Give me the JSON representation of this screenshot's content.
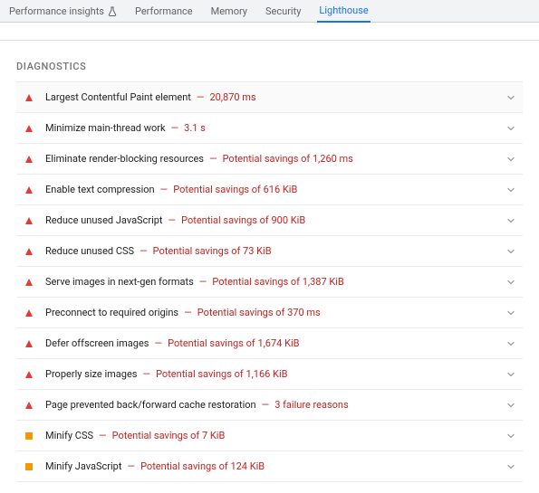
{
  "tabs": {
    "performance_insights": "Performance insights",
    "performance": "Performance",
    "memory": "Memory",
    "security": "Security",
    "lighthouse": "Lighthouse"
  },
  "section_title": "DIAGNOSTICS",
  "separator": "—",
  "items": [
    {
      "severity": "error",
      "label": "Largest Contentful Paint element",
      "detail": "20,870 ms"
    },
    {
      "severity": "error",
      "label": "Minimize main-thread work",
      "detail": "3.1 s"
    },
    {
      "severity": "error",
      "label": "Eliminate render-blocking resources",
      "detail": "Potential savings of 1,260 ms"
    },
    {
      "severity": "error",
      "label": "Enable text compression",
      "detail": "Potential savings of 616 KiB"
    },
    {
      "severity": "error",
      "label": "Reduce unused JavaScript",
      "detail": "Potential savings of 900 KiB"
    },
    {
      "severity": "error",
      "label": "Reduce unused CSS",
      "detail": "Potential savings of 73 KiB"
    },
    {
      "severity": "error",
      "label": "Serve images in next-gen formats",
      "detail": "Potential savings of 1,387 KiB"
    },
    {
      "severity": "error",
      "label": "Preconnect to required origins",
      "detail": "Potential savings of 370 ms"
    },
    {
      "severity": "error",
      "label": "Defer offscreen images",
      "detail": "Potential savings of 1,674 KiB"
    },
    {
      "severity": "error",
      "label": "Properly size images",
      "detail": "Potential savings of 1,166 KiB"
    },
    {
      "severity": "error",
      "label": "Page prevented back/forward cache restoration",
      "detail": "3 failure reasons"
    },
    {
      "severity": "warn",
      "label": "Minify CSS",
      "detail": "Potential savings of 7 KiB"
    },
    {
      "severity": "warn",
      "label": "Minify JavaScript",
      "detail": "Potential savings of 124 KiB"
    }
  ]
}
